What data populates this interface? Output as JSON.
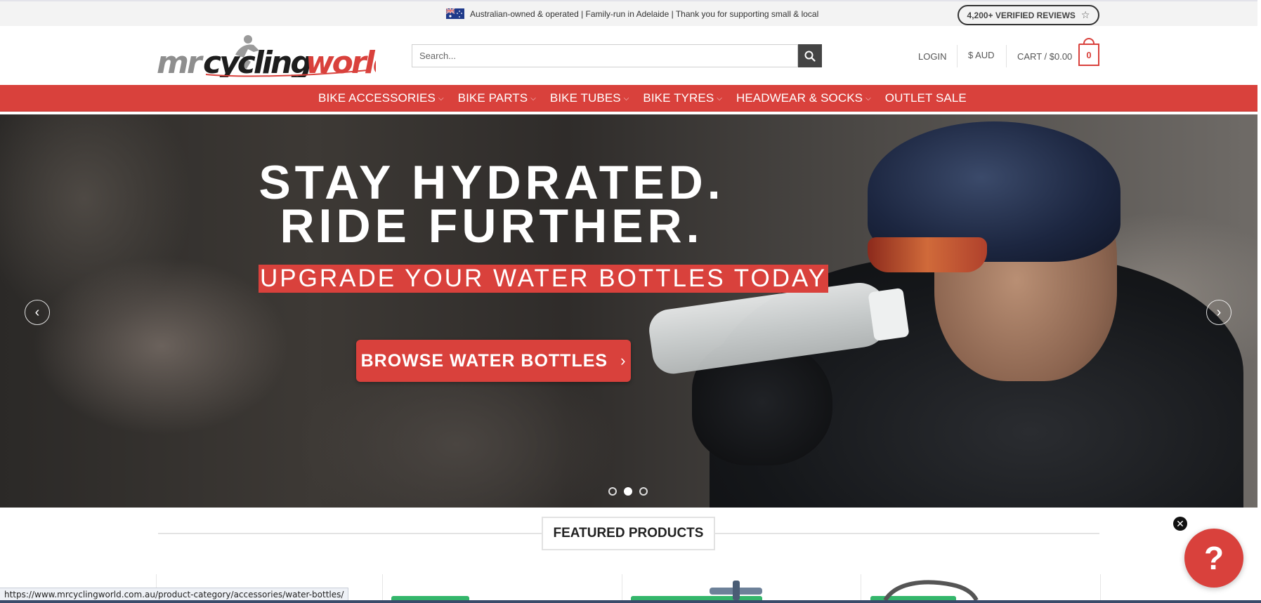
{
  "topbar": {
    "message": "Australian-owned & operated | Family-run in Adelaide | Thank you for supporting small & local",
    "reviews": "4,200+ VERIFIED REVIEWS"
  },
  "header": {
    "logo_text": "mrcyclingworld",
    "search_placeholder": "Search...",
    "login": "LOGIN",
    "currency": "$ AUD",
    "cart_label": "CART / $0.00",
    "cart_count": "0"
  },
  "nav": {
    "items": [
      {
        "label": "BIKE ACCESSORIES",
        "has_dropdown": true
      },
      {
        "label": "BIKE PARTS",
        "has_dropdown": true
      },
      {
        "label": "BIKE TUBES",
        "has_dropdown": true
      },
      {
        "label": "BIKE TYRES",
        "has_dropdown": true
      },
      {
        "label": "HEADWEAR & SOCKS",
        "has_dropdown": true
      },
      {
        "label": "OUTLET SALE",
        "has_dropdown": false
      }
    ]
  },
  "hero": {
    "title_line1": "STAY HYDRATED.",
    "title_line2": "RIDE FURTHER.",
    "subtitle": "UPGRADE YOUR WATER BOTTLES TODAY",
    "button": "BROWSE WATER BOTTLES",
    "active_slide": 2,
    "slide_count": 3
  },
  "featured": {
    "heading": "FEATURED PRODUCTS"
  },
  "help": {
    "icon": "?"
  },
  "status_bar": {
    "url": "https://www.mrcyclingworld.com.au/product-category/accessories/water-bottles/"
  },
  "colors": {
    "brand_red": "#d9413c",
    "sale_green": "#34b66b"
  }
}
